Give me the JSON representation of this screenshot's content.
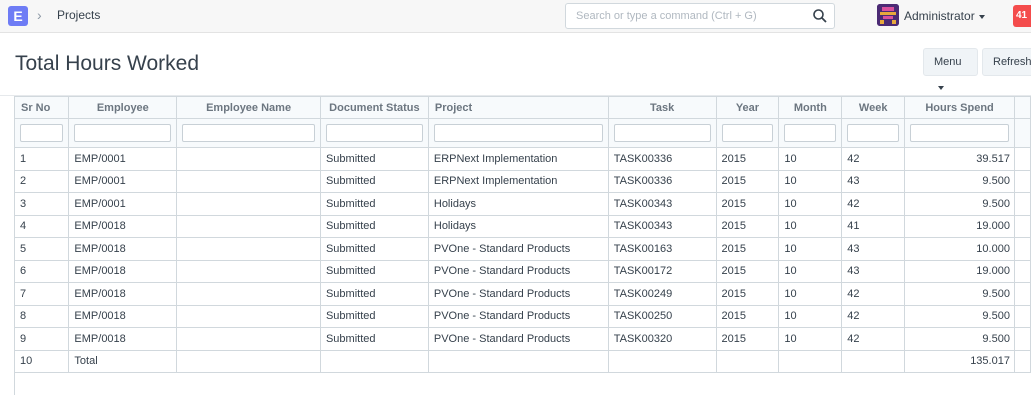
{
  "navbar": {
    "logo_letter": "E",
    "breadcrumb": "Projects",
    "search_placeholder": "Search or type a command (Ctrl + G)",
    "user_name": "Administrator",
    "notification_count": "41"
  },
  "page": {
    "title": "Total Hours Worked",
    "menu_label": "Menu",
    "refresh_label": "Refresh"
  },
  "table": {
    "columns": [
      "Sr No",
      "Employee",
      "Employee Name",
      "Document Status",
      "Project",
      "Task",
      "Year",
      "Month",
      "Week",
      "Hours Spend"
    ],
    "rows": [
      {
        "sr": "1",
        "employee": "EMP/0001",
        "name": "",
        "status": "Submitted",
        "project": "ERPNext Implementation",
        "task": "TASK00336",
        "year": "2015",
        "month": "10",
        "week": "42",
        "hours": "39.517"
      },
      {
        "sr": "2",
        "employee": "EMP/0001",
        "name": "",
        "status": "Submitted",
        "project": "ERPNext Implementation",
        "task": "TASK00336",
        "year": "2015",
        "month": "10",
        "week": "43",
        "hours": "9.500"
      },
      {
        "sr": "3",
        "employee": "EMP/0001",
        "name": "",
        "status": "Submitted",
        "project": "Holidays",
        "task": "TASK00343",
        "year": "2015",
        "month": "10",
        "week": "42",
        "hours": "9.500"
      },
      {
        "sr": "4",
        "employee": "EMP/0018",
        "name": "",
        "status": "Submitted",
        "project": "Holidays",
        "task": "TASK00343",
        "year": "2015",
        "month": "10",
        "week": "41",
        "hours": "19.000"
      },
      {
        "sr": "5",
        "employee": "EMP/0018",
        "name": "",
        "status": "Submitted",
        "project": "PVOne - Standard Products",
        "task": "TASK00163",
        "year": "2015",
        "month": "10",
        "week": "43",
        "hours": "10.000"
      },
      {
        "sr": "6",
        "employee": "EMP/0018",
        "name": "",
        "status": "Submitted",
        "project": "PVOne - Standard Products",
        "task": "TASK00172",
        "year": "2015",
        "month": "10",
        "week": "43",
        "hours": "19.000"
      },
      {
        "sr": "7",
        "employee": "EMP/0018",
        "name": "",
        "status": "Submitted",
        "project": "PVOne - Standard Products",
        "task": "TASK00249",
        "year": "2015",
        "month": "10",
        "week": "42",
        "hours": "9.500"
      },
      {
        "sr": "8",
        "employee": "EMP/0018",
        "name": "",
        "status": "Submitted",
        "project": "PVOne - Standard Products",
        "task": "TASK00250",
        "year": "2015",
        "month": "10",
        "week": "42",
        "hours": "9.500"
      },
      {
        "sr": "9",
        "employee": "EMP/0018",
        "name": "",
        "status": "Submitted",
        "project": "PVOne - Standard Products",
        "task": "TASK00320",
        "year": "2015",
        "month": "10",
        "week": "42",
        "hours": "9.500"
      }
    ],
    "total": {
      "sr": "10",
      "label": "Total",
      "hours": "135.017"
    }
  },
  "colors": {
    "accent": "#6e7cf5",
    "notification": "#f44c4c",
    "avatar": "#4b2a74"
  }
}
